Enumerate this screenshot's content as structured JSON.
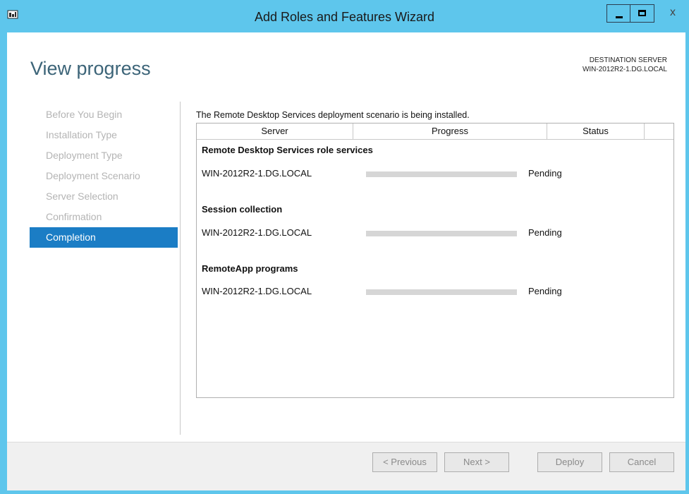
{
  "window": {
    "title": "Add Roles and Features Wizard",
    "close_glyph": "x"
  },
  "header": {
    "page_title": "View progress",
    "destination_label": "DESTINATION SERVER",
    "destination_server": "WIN-2012R2-1.DG.LOCAL"
  },
  "steps": [
    {
      "label": "Before You Begin",
      "active": false
    },
    {
      "label": "Installation Type",
      "active": false
    },
    {
      "label": "Deployment Type",
      "active": false
    },
    {
      "label": "Deployment Scenario",
      "active": false
    },
    {
      "label": "Server Selection",
      "active": false
    },
    {
      "label": "Confirmation",
      "active": false
    },
    {
      "label": "Completion",
      "active": true
    }
  ],
  "content": {
    "intro": "The Remote Desktop Services deployment scenario is being installed.",
    "columns": [
      "Server",
      "Progress",
      "Status"
    ],
    "groups": [
      {
        "name": "Remote Desktop Services role services",
        "server": "WIN-2012R2-1.DG.LOCAL",
        "progress": 0,
        "status": "Pending"
      },
      {
        "name": "Session collection",
        "server": "WIN-2012R2-1.DG.LOCAL",
        "progress": 0,
        "status": "Pending"
      },
      {
        "name": "RemoteApp programs",
        "server": "WIN-2012R2-1.DG.LOCAL",
        "progress": 0,
        "status": "Pending"
      }
    ]
  },
  "footer": {
    "previous": "< Previous",
    "next": "Next >",
    "deploy": "Deploy",
    "cancel": "Cancel"
  },
  "colors": {
    "titlebar": "#5ec6ec",
    "active_step": "#1b7dc5",
    "progress_track": "#d6d6d6"
  },
  "icons": {
    "app": "server-manager-icon",
    "minimize": "minimize-icon",
    "maximize": "maximize-icon",
    "close": "close-icon"
  }
}
